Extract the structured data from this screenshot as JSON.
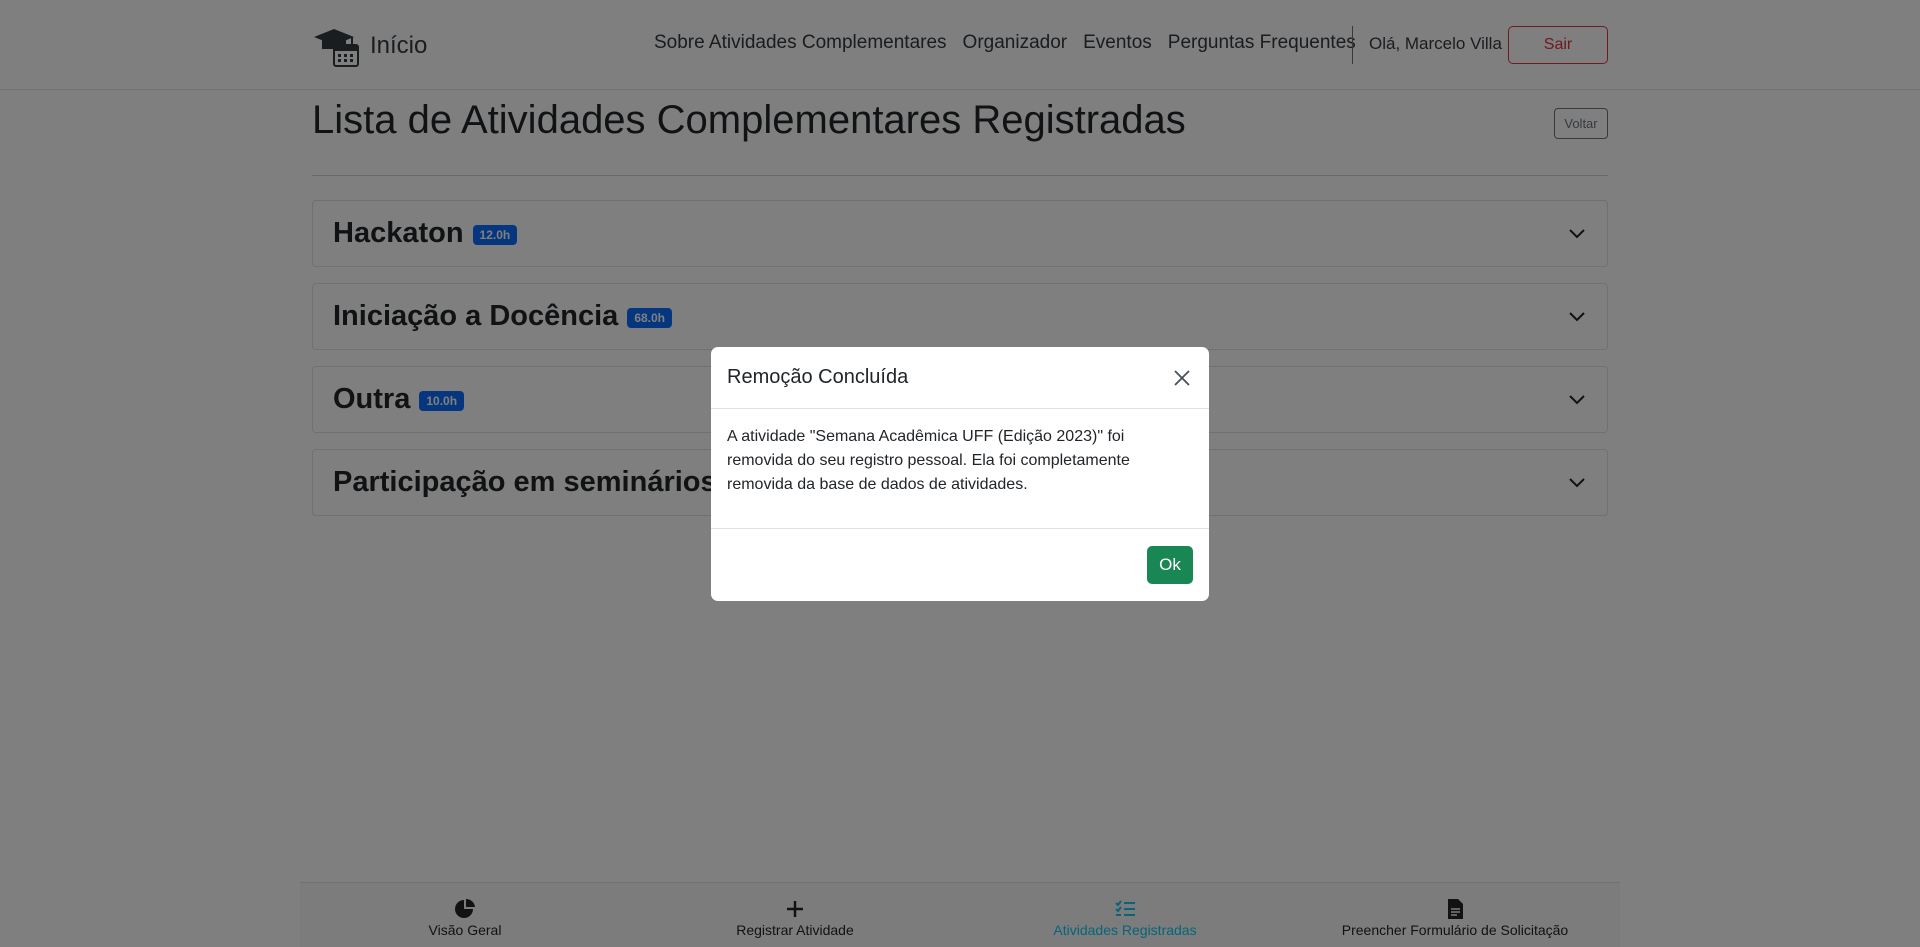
{
  "navbar": {
    "brand_label": "Início",
    "links": [
      "Sobre Atividades Complementares",
      "Organizador",
      "Eventos",
      "Perguntas Frequentes"
    ],
    "greeting": "Olá, Marcelo Villa",
    "logout_label": "Sair"
  },
  "main": {
    "title": "Lista de Atividades Complementares Registradas",
    "back_label": "Voltar",
    "accordion": [
      {
        "title": "Hackaton",
        "badge": "12.0h"
      },
      {
        "title": "Iniciação a Docência",
        "badge": "68.0h"
      },
      {
        "title": "Outra",
        "badge": "10.0h"
      },
      {
        "title": "Participação em seminários, c",
        "badge": ""
      }
    ]
  },
  "bottom_nav": {
    "items": [
      {
        "label": "Visão Geral",
        "icon": "pie-chart-icon"
      },
      {
        "label": "Registrar Atividade",
        "icon": "plus-icon"
      },
      {
        "label": "Atividades Registradas",
        "icon": "list-check-icon"
      },
      {
        "label": "Preencher Formulário de Solicitação",
        "icon": "document-icon"
      }
    ],
    "active_index": 2
  },
  "modal": {
    "title": "Remoção Concluída",
    "body": "A atividade \"Semana Acadêmica UFF (Edição 2023)\" foi removida do seu registro pessoal. Ela foi completamente removida da base de dados de atividades.",
    "ok_label": "Ok"
  },
  "colors": {
    "primary": "#0d6efd",
    "danger": "#dc3545",
    "success": "#198754",
    "active_nav": "#0dcaf0"
  }
}
